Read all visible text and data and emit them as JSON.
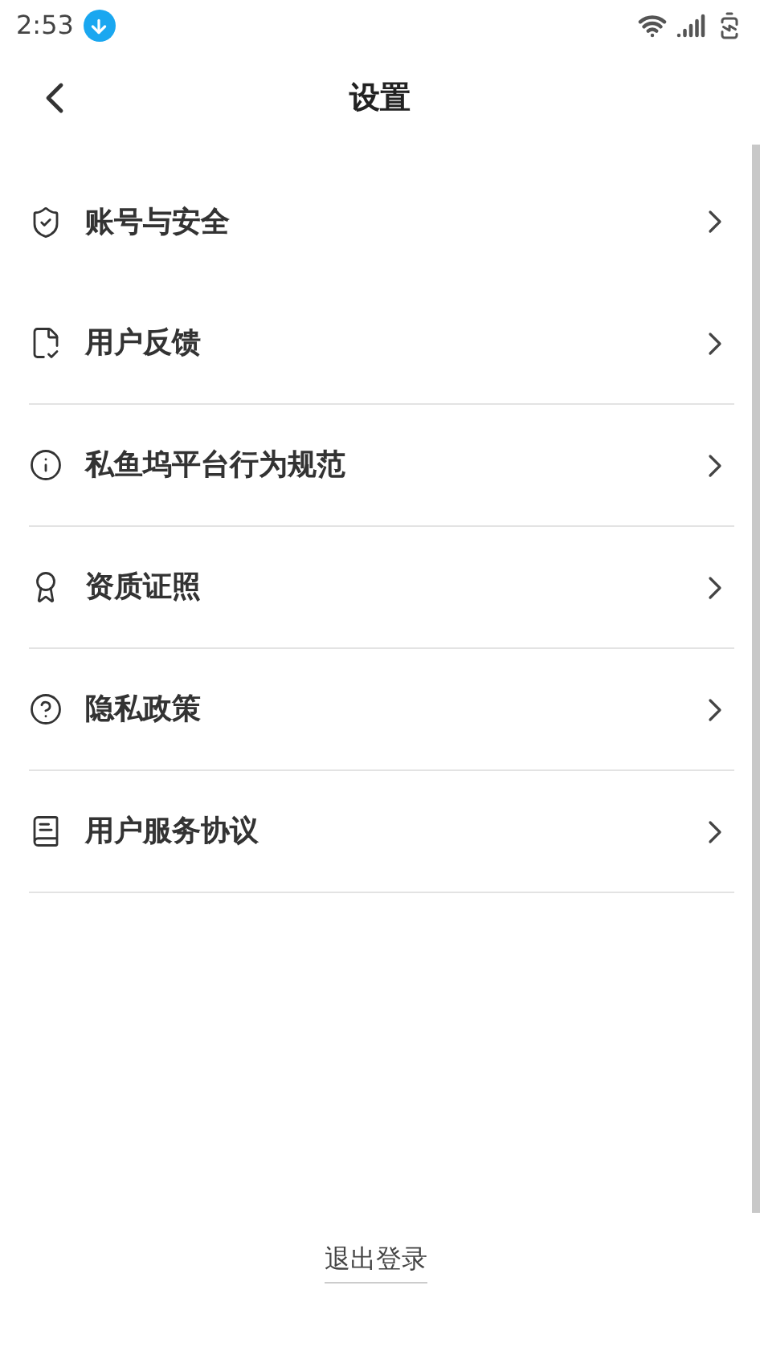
{
  "status_bar": {
    "time": "2:53"
  },
  "header": {
    "title": "设置"
  },
  "items": [
    {
      "label": "账号与安全"
    },
    {
      "label": "用户反馈"
    },
    {
      "label": "私鱼坞平台行为规范"
    },
    {
      "label": "资质证照"
    },
    {
      "label": "隐私政策"
    },
    {
      "label": "用户服务协议"
    }
  ],
  "logout": {
    "label": "退出登录"
  }
}
